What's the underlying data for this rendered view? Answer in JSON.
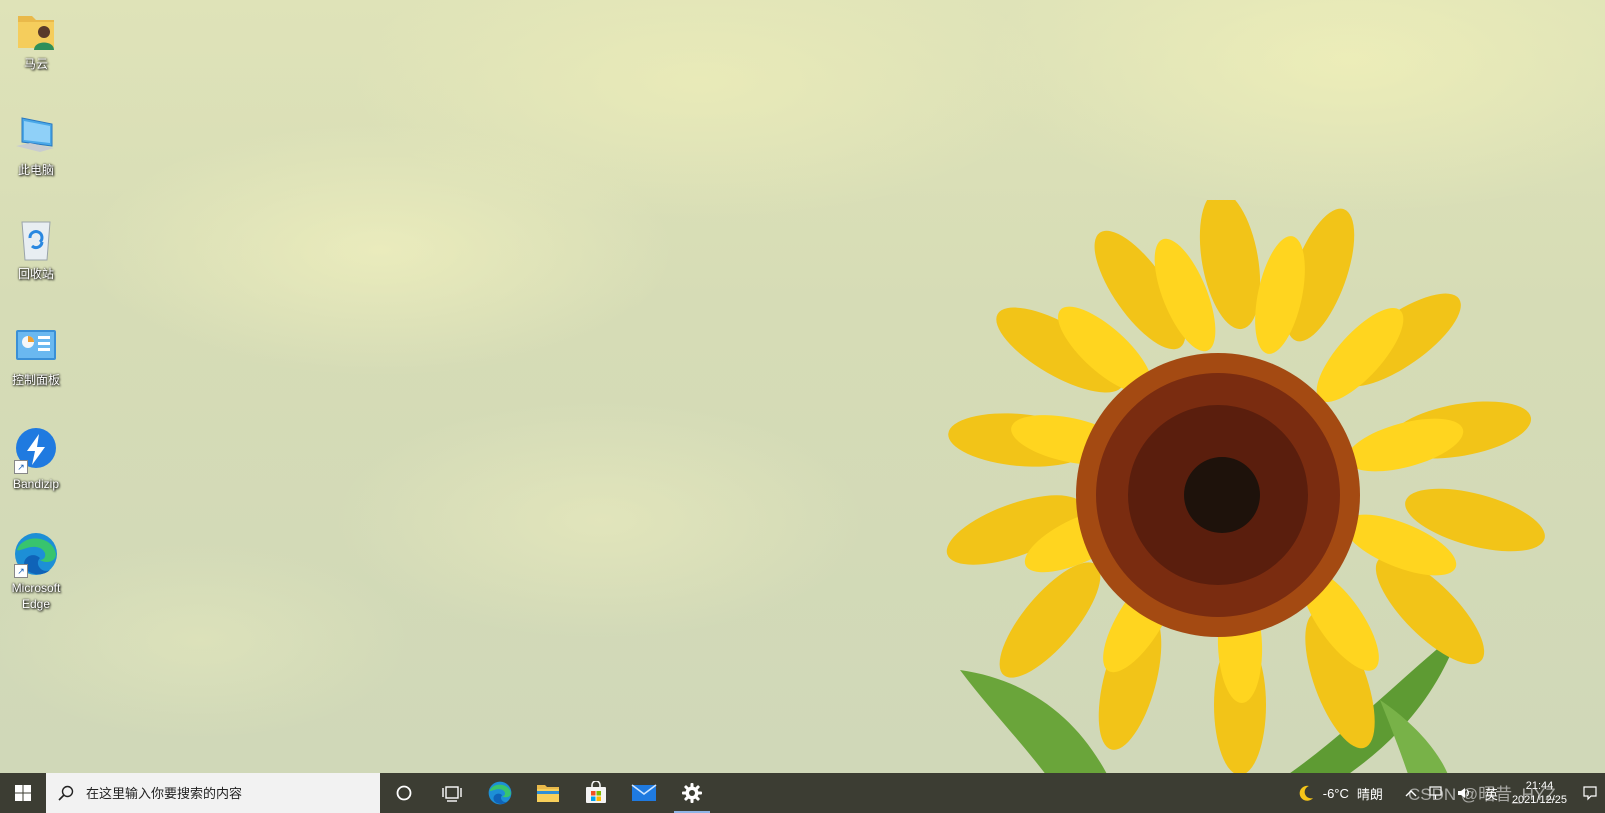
{
  "desktop": {
    "icons": [
      {
        "label": "马云",
        "icon": "user-folder-icon"
      },
      {
        "label": "此电脑",
        "icon": "computer-icon"
      },
      {
        "label": "回收站",
        "icon": "recycle-bin-icon"
      },
      {
        "label": "控制面板",
        "icon": "control-panel-icon"
      },
      {
        "label": "Bandizip",
        "icon": "bandizip-icon"
      },
      {
        "label": "Microsoft Edge",
        "icon": "edge-icon"
      }
    ]
  },
  "taskbar": {
    "start_icon": "windows-icon",
    "search": {
      "placeholder": "在这里输入你要搜索的内容",
      "icon": "search-icon"
    },
    "pinned": [
      {
        "name": "cortana",
        "icon": "circle-icon"
      },
      {
        "name": "task-view",
        "icon": "task-view-icon"
      },
      {
        "name": "edge",
        "icon": "edge-icon"
      },
      {
        "name": "file-explorer",
        "icon": "folder-icon"
      },
      {
        "name": "store",
        "icon": "store-icon"
      },
      {
        "name": "mail",
        "icon": "mail-icon"
      },
      {
        "name": "settings",
        "icon": "gear-icon",
        "active": true
      }
    ],
    "tray": {
      "weather_icon": "moon-icon",
      "temperature": "-6°C",
      "condition": "晴朗",
      "chevron": "^",
      "ime": "英",
      "time": "21:44",
      "date": "2021/12/25"
    },
    "watermark": "CSDN @昭昔_HYZ"
  },
  "colors": {
    "taskbar_bg": "#3c3d33",
    "search_bg": "#f2f2f2",
    "active_indicator": "#8fb4e6"
  }
}
